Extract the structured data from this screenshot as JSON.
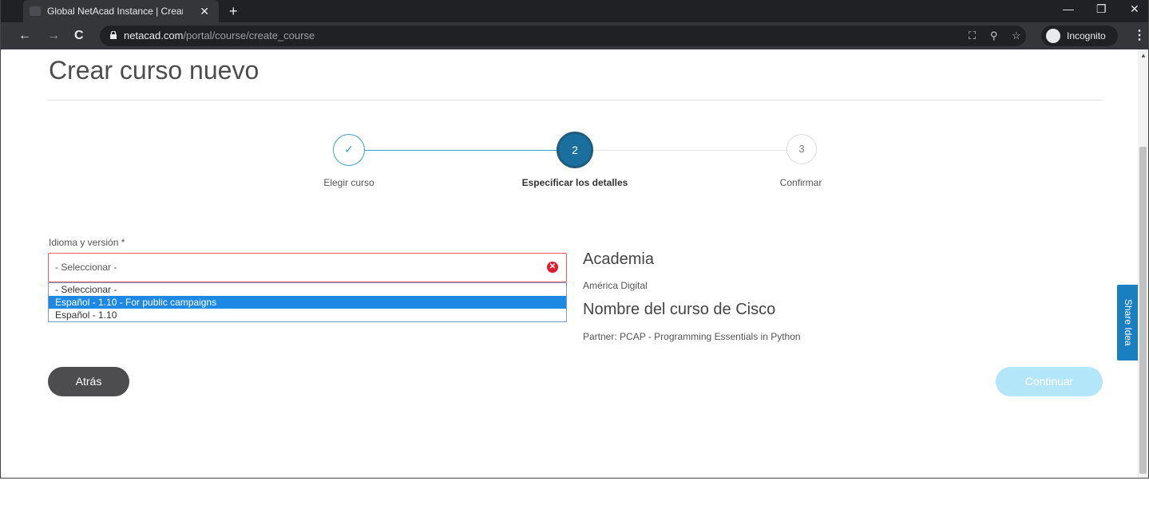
{
  "browser": {
    "tab_title": "Global NetAcad Instance | Crear c",
    "tab_close": "✕",
    "new_tab": "+",
    "url_host": "netacad.com",
    "url_path": "/portal/course/create_course",
    "incognito_label": "Incognito",
    "window_controls": {
      "minimize": "—",
      "restore": "❐",
      "close": "✕"
    },
    "nav": {
      "back": "←",
      "forward": "→",
      "reload": "C"
    },
    "icons": [
      "lock-icon",
      "translate-icon",
      "zoom-icon",
      "star-icon",
      "incognito-icon",
      "menu-icon"
    ]
  },
  "page": {
    "title": "Crear curso nuevo",
    "stepper": {
      "steps": [
        {
          "label": "Elegir curso",
          "state": "done",
          "glyph": "✓"
        },
        {
          "label": "Especificar los detalles",
          "state": "active",
          "number": "2"
        },
        {
          "label": "Confirmar",
          "state": "pending",
          "number": "3"
        }
      ],
      "colors": {
        "accent": "#1a6f9e",
        "done_line": "#3aa0c8",
        "pending_line": "#e3e3e3"
      }
    },
    "form": {
      "language_label": "Idioma y versión *",
      "select_value": "- Seleccionar -",
      "error_glyph": "✕",
      "options": [
        {
          "label": "- Seleccionar -",
          "selected": false
        },
        {
          "label": "Español - 1.10 - For public campaigns",
          "selected": true
        },
        {
          "label": "Español - 1.10",
          "selected": false
        }
      ]
    },
    "details": {
      "academy_heading": "Academia",
      "academy_value": "América Digital",
      "course_heading": "Nombre del curso de Cisco",
      "course_value": "Partner: PCAP - Programming Essentials in Python"
    },
    "buttons": {
      "back": "Atrás",
      "continue": "Continuar"
    },
    "share_idea": "Share Idea"
  },
  "colors": {
    "error": "#e01d2a",
    "option_highlight": "#1e88e5",
    "back_button": "#4d4d4f",
    "continue_disabled": "#b4e6f9",
    "share_idea": "#1a7fc1"
  }
}
